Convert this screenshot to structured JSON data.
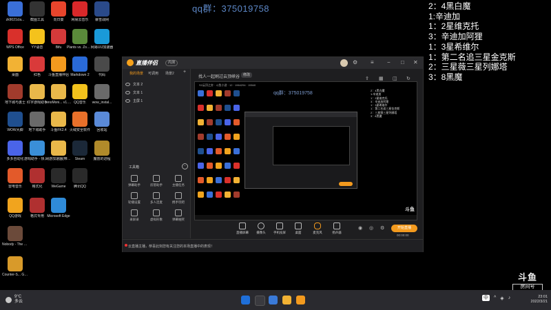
{
  "overlay": {
    "qq_group": "qq群：375019758",
    "ranking": [
      "2：4黑白魔",
      "1:辛迪加",
      "1：2星维克托",
      "3：辛迪加阿狸",
      "1：3星希维尔",
      "1：第二名追三星金克斯",
      "2：三星薇三星列娜塔",
      "3：8黑魔"
    ]
  },
  "desktop": {
    "icons": [
      {
        "label": "zk9021cla...",
        "icon": "blue-square-icon",
        "color": "#3a6fd8"
      },
      {
        "label": "WPS Office",
        "icon": "wps-icon",
        "color": "#d9302b"
      },
      {
        "label": "桌面",
        "icon": "pet-icon",
        "color": "#f2b234"
      },
      {
        "label": "地下城与勇士",
        "icon": "game-icon",
        "color": "#a13b2c"
      },
      {
        "label": "WOW大脚",
        "icon": "wow-icon",
        "color": "#1f4f8f"
      },
      {
        "label": "多多自动化",
        "icon": "app-icon",
        "color": "#4a64e8"
      },
      {
        "label": "雷电音乐",
        "icon": "music-icon",
        "color": "#e35a2a"
      },
      {
        "label": "QQ游戏",
        "icon": "qq-game-icon",
        "color": "#f1a41e"
      },
      {
        "label": "Nobody - The Turni...",
        "icon": "game-icon",
        "color": "#6b4a3a"
      },
      {
        "label": "Counter-S... Global Off...",
        "icon": "cs-icon",
        "color": "#d89a2a"
      },
      {
        "label": "截图工具",
        "icon": "scissors-icon",
        "color": "#333333"
      },
      {
        "label": "YY语音",
        "icon": "yy-icon",
        "color": "#f4c21c"
      },
      {
        "label": "红色",
        "icon": "app-icon",
        "color": "#d93a3a"
      },
      {
        "label": "红字游戏助手",
        "icon": "folder-icon",
        "color": "#e9b84a"
      },
      {
        "label": "地下城助手",
        "icon": "game-icon",
        "color": "#6a6a6a"
      },
      {
        "label": "游戏助手 - 快速加",
        "icon": "monitor-icon",
        "color": "#3a8fd8"
      },
      {
        "label": "格式化",
        "icon": "app-icon",
        "color": "#b03030"
      },
      {
        "label": "格式专用",
        "icon": "app-icon",
        "color": "#b03030"
      },
      {
        "label": "向日葵",
        "icon": "sunflower-icon",
        "color": "#e8452c"
      },
      {
        "label": "Bifu",
        "icon": "app-icon",
        "color": "#d43a3a"
      },
      {
        "label": "斗鱼直播伴侣",
        "icon": "douyu-icon",
        "color": "#f39a1e"
      },
      {
        "label": "lonoMoni... v1.0.8_beta",
        "icon": "folder-icon",
        "color": "#e9b84a"
      },
      {
        "label": "斗鱼FK2.4",
        "icon": "folder-icon",
        "color": "#e9b84a"
      },
      {
        "label": "网游加速器(带特别)",
        "icon": "folder-icon",
        "color": "#e9b84a"
      },
      {
        "label": "WeGame",
        "icon": "wegame-icon",
        "color": "#2a2a2a"
      },
      {
        "label": "Microsoft Edge",
        "icon": "edge-icon",
        "color": "#2f8bd8"
      },
      {
        "label": "网易云音乐",
        "icon": "netease-icon",
        "color": "#d8282a"
      },
      {
        "label": "Plants vs. Zombies G...",
        "icon": "game-icon",
        "color": "#5a8a3a"
      },
      {
        "label": "Markdown 2",
        "icon": "markdown-icon",
        "color": "#2a6ad8"
      },
      {
        "label": "QQ音乐",
        "icon": "qq-music-icon",
        "color": "#f2c21c"
      },
      {
        "label": "火绒安全软件",
        "icon": "app-icon",
        "color": "#e8702a"
      },
      {
        "label": "Steam",
        "icon": "steam-icon",
        "color": "#1b2838"
      },
      {
        "label": "腾讯QQ",
        "icon": "qq-icon",
        "color": "#2a2a2a"
      },
      {
        "label": "暴雪战网",
        "icon": "battlenet-icon",
        "color": "#2a4a8a"
      },
      {
        "label": "网易UU加速器",
        "icon": "uu-icon",
        "color": "#1a9ad8"
      },
      {
        "label": "代码",
        "icon": "app-icon",
        "color": "#4a4a4a"
      },
      {
        "label": "wow_instal...",
        "icon": "app-icon",
        "color": "#6a6a6a"
      },
      {
        "label": "回收站",
        "icon": "recycle-bin-icon",
        "color": "#5a8ad8"
      },
      {
        "label": "魔兽的进程",
        "icon": "wow-icon",
        "color": "#b08a2a"
      }
    ]
  },
  "app": {
    "name": "直播伴侣",
    "badge": "内测",
    "left_tabs": [
      "我的场景",
      "可调用",
      "场景2"
    ],
    "scenes": [
      "文本 2",
      "文本 1",
      "主屏 1"
    ],
    "tools_title": "工具箱",
    "tools": [
      "弹幕助手",
      "房管助手",
      "主播任务",
      "轮播设置",
      "多人连麦",
      "携手玩吧",
      "录屏录",
      "虚拟形象",
      "弹幕抽奖"
    ],
    "stream_title": "找人一起刷过云顶峡谷",
    "stream_tag": "修改",
    "room_info": "S2云顶之弈 · 斗鱼小游 · 12 · 1964294 · 15540",
    "preview_qq": "qq群：375019758",
    "bottom_tools": [
      "直播屏幕",
      "摄像头",
      "手机投屏",
      "桌面",
      "麦克风",
      "扬声器"
    ],
    "live_button": "开始直播",
    "live_time": "00:00:00",
    "status_text": "云直播主播，恭喜此刻您有关注您的本场直播中的表现！"
  },
  "watermark": {
    "line1": "斗鱼",
    "line2": "房间号"
  },
  "taskbar": {
    "weather_temp": "9°C",
    "weather_desc": "多云",
    "ime": "中",
    "time": "23:01",
    "date": "2022/3/21"
  }
}
